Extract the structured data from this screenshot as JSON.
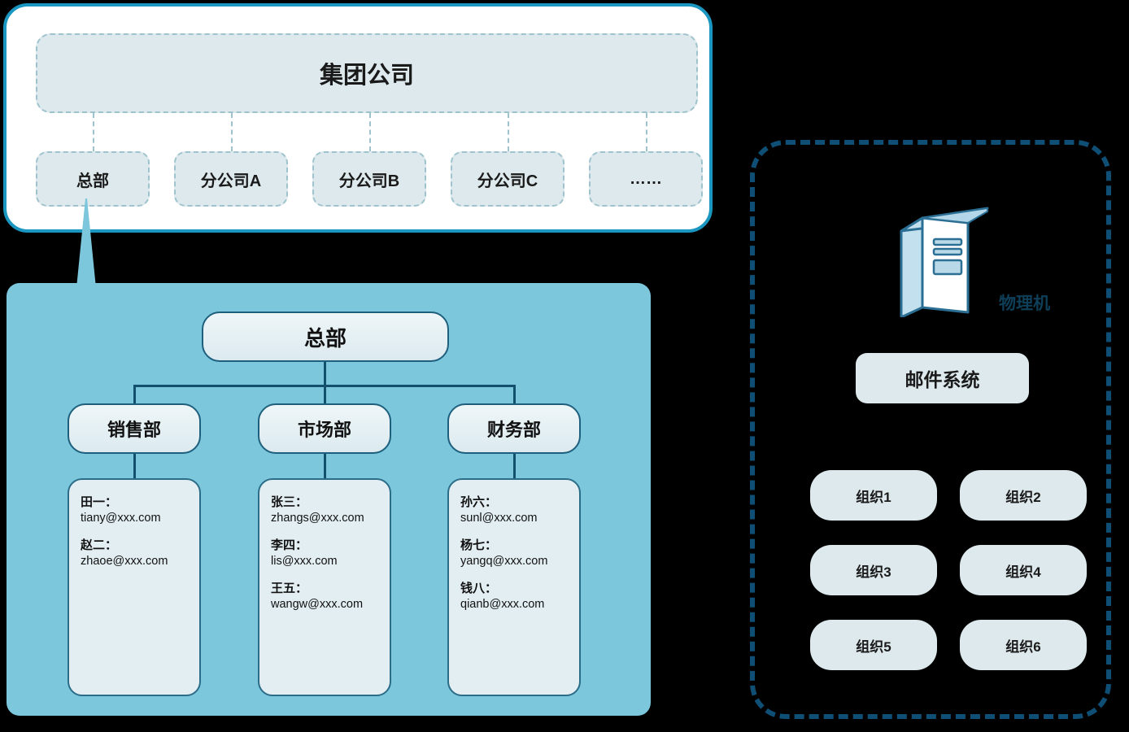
{
  "left_top_panel": {
    "group_company": "集团公司",
    "branches": [
      {
        "label": "总部"
      },
      {
        "label": "分公司A"
      },
      {
        "label": "分公司B"
      },
      {
        "label": "分公司C"
      },
      {
        "label": "……"
      }
    ]
  },
  "left_bottom_panel": {
    "root": "总部",
    "departments": [
      {
        "name": "销售部",
        "members": [
          {
            "name": "田一：",
            "email": "tiany@xxx.com"
          },
          {
            "name": "赵二：",
            "email": "zhaoe@xxx.com"
          }
        ]
      },
      {
        "name": "市场部",
        "members": [
          {
            "name": "张三：",
            "email": "zhangs@xxx.com"
          },
          {
            "name": "李四：",
            "email": "lis@xxx.com"
          },
          {
            "name": "王五：",
            "email": "wangw@xxx.com"
          }
        ]
      },
      {
        "name": "财务部",
        "members": [
          {
            "name": "孙六：",
            "email": "sunl@xxx.com"
          },
          {
            "name": "杨七：",
            "email": "yangq@xxx.com"
          },
          {
            "name": "钱八：",
            "email": "qianb@xxx.com"
          }
        ]
      }
    ]
  },
  "right_panel": {
    "server_label": "物理机",
    "mail_system": "邮件系统",
    "organizations": [
      {
        "label": "组织1"
      },
      {
        "label": "组织2"
      },
      {
        "label": "组织3"
      },
      {
        "label": "组织4"
      },
      {
        "label": "组织5"
      },
      {
        "label": "组织6"
      }
    ]
  },
  "colors": {
    "panel_border_teal": "#1b96c0",
    "panel_blue_fill": "#7cc7dc",
    "box_fill_light": "#dde9ec",
    "node_border_navy": "#1e5f7d",
    "connector_navy": "#13506e",
    "dashed_navy": "#0f4f75",
    "canvas_background": "#000000"
  }
}
